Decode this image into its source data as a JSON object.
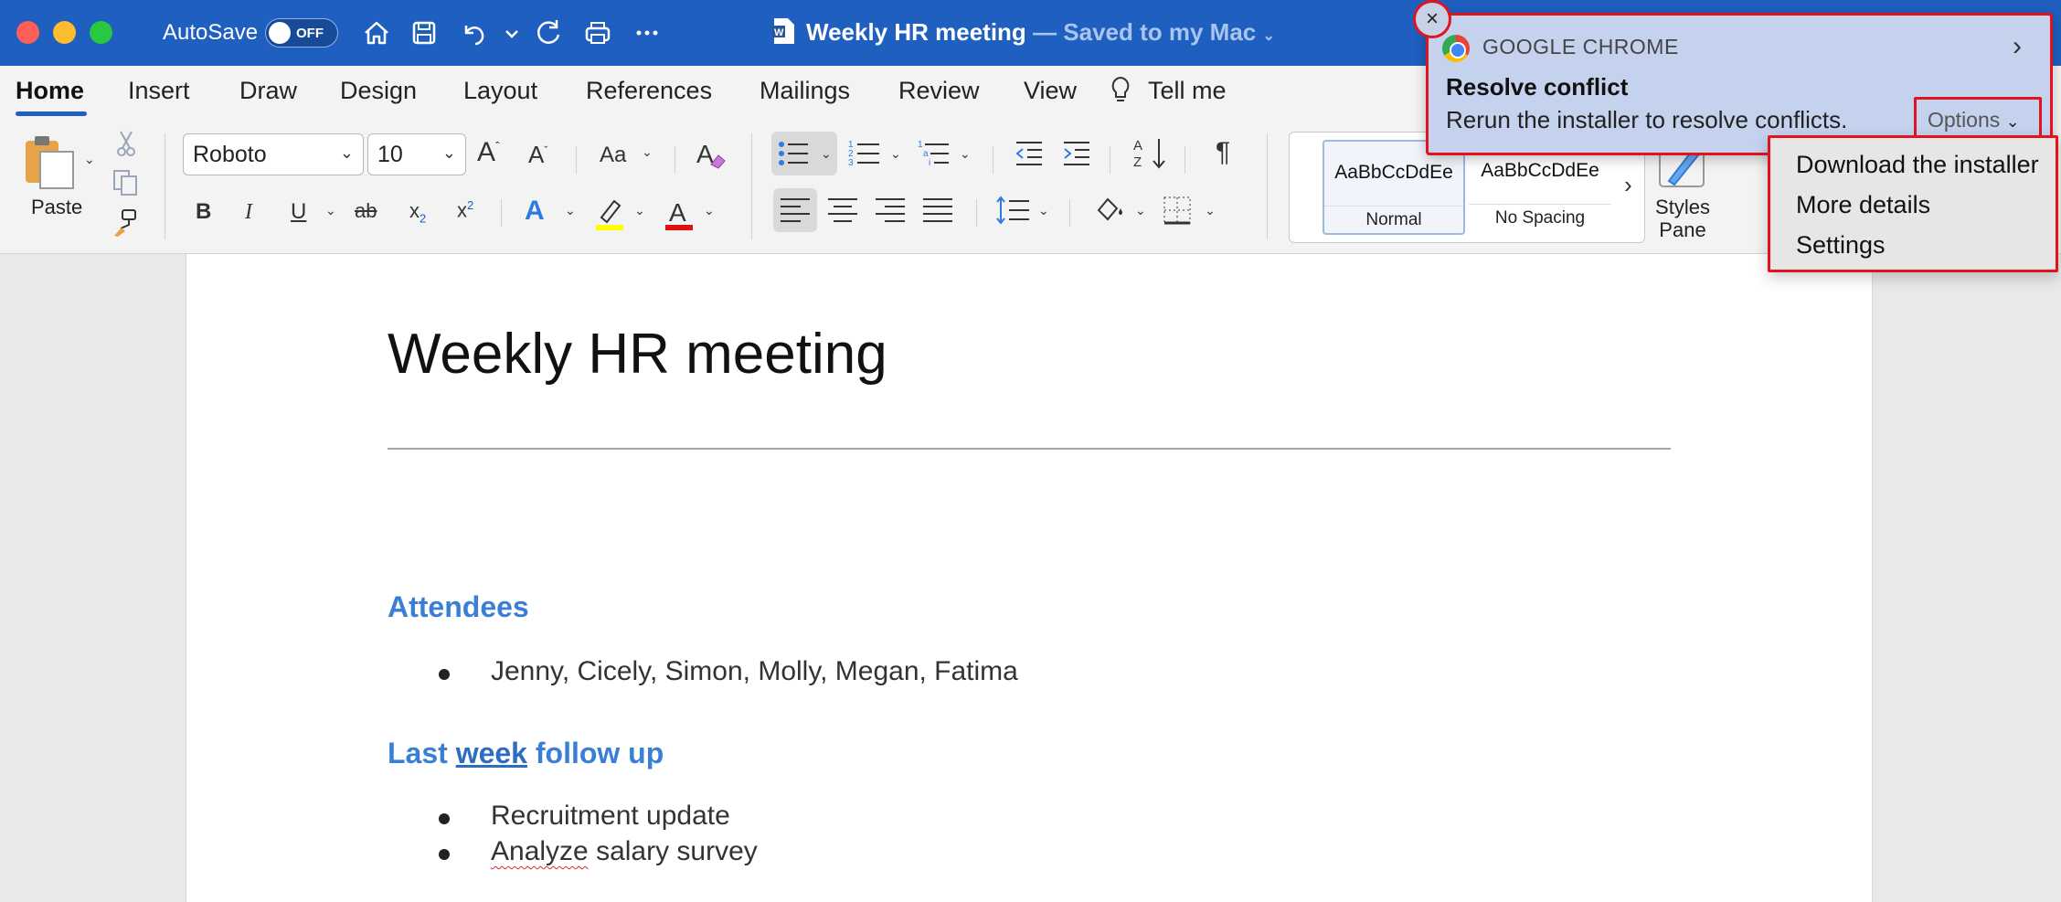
{
  "window": {
    "autosave_label": "AutoSave",
    "autosave_state": "OFF",
    "doc_title": "Weekly HR meeting",
    "doc_saved": "— Saved to my Mac",
    "titlebar_color": "#1f5fbf"
  },
  "tabs": [
    {
      "label": "Home"
    },
    {
      "label": "Insert"
    },
    {
      "label": "Draw"
    },
    {
      "label": "Design"
    },
    {
      "label": "Layout"
    },
    {
      "label": "References"
    },
    {
      "label": "Mailings"
    },
    {
      "label": "Review"
    },
    {
      "label": "View"
    },
    {
      "label": "Tell me"
    }
  ],
  "ribbon": {
    "paste_label": "Paste",
    "font_name": "Roboto",
    "font_size": "10",
    "styles": [
      {
        "sample": "AaBbCcDdEe",
        "name": "Normal"
      },
      {
        "sample": "AaBbCcDdEe",
        "name": "No Spacing"
      }
    ],
    "styles_pane_label": "Styles Pane"
  },
  "document": {
    "title": "Weekly HR meeting",
    "attendees_heading": "Attendees",
    "attendees": "Jenny, Cicely, Simon, Molly, Megan, Fatima",
    "followup_heading_pre": "Last ",
    "followup_heading_link": "week",
    "followup_heading_post": " follow up",
    "followup_items": [
      "Recruitment update",
      "Analyze",
      " salary survey"
    ],
    "heading_color": "#3a7fd6"
  },
  "notification": {
    "app": "GOOGLE CHROME",
    "title": "Resolve conflict",
    "body": "Rerun the installer to resolve conflicts.",
    "options_label": "Options",
    "menu": [
      "Download the installer",
      "More details",
      "Settings"
    ]
  }
}
